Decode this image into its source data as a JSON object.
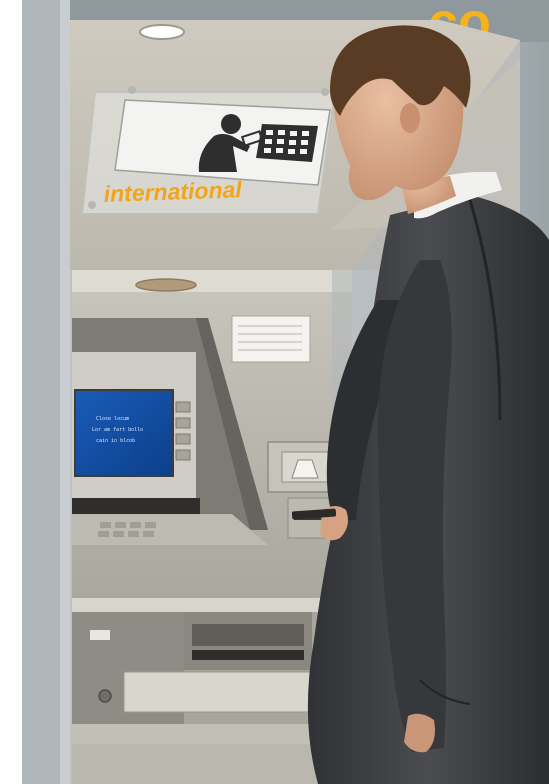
{
  "scene": {
    "description_free": true,
    "sign_label": "international",
    "brand_fragment": "co",
    "screen_lines": [
      "Close locum",
      "Lor am fart bollo",
      "cain in blcob"
    ],
    "colors": {
      "sign_text": "#f2a51c",
      "brand": "#f5b21a",
      "screen_bg": "#0f4fa8",
      "screen_text": "#d8e6ff",
      "atm_body": "#b9b6ad",
      "suit": "#3b3d40",
      "frame": "#9aa3a8"
    },
    "icons": [
      "atm-user-pictogram-icon",
      "keypad-pictogram-icon"
    ]
  }
}
